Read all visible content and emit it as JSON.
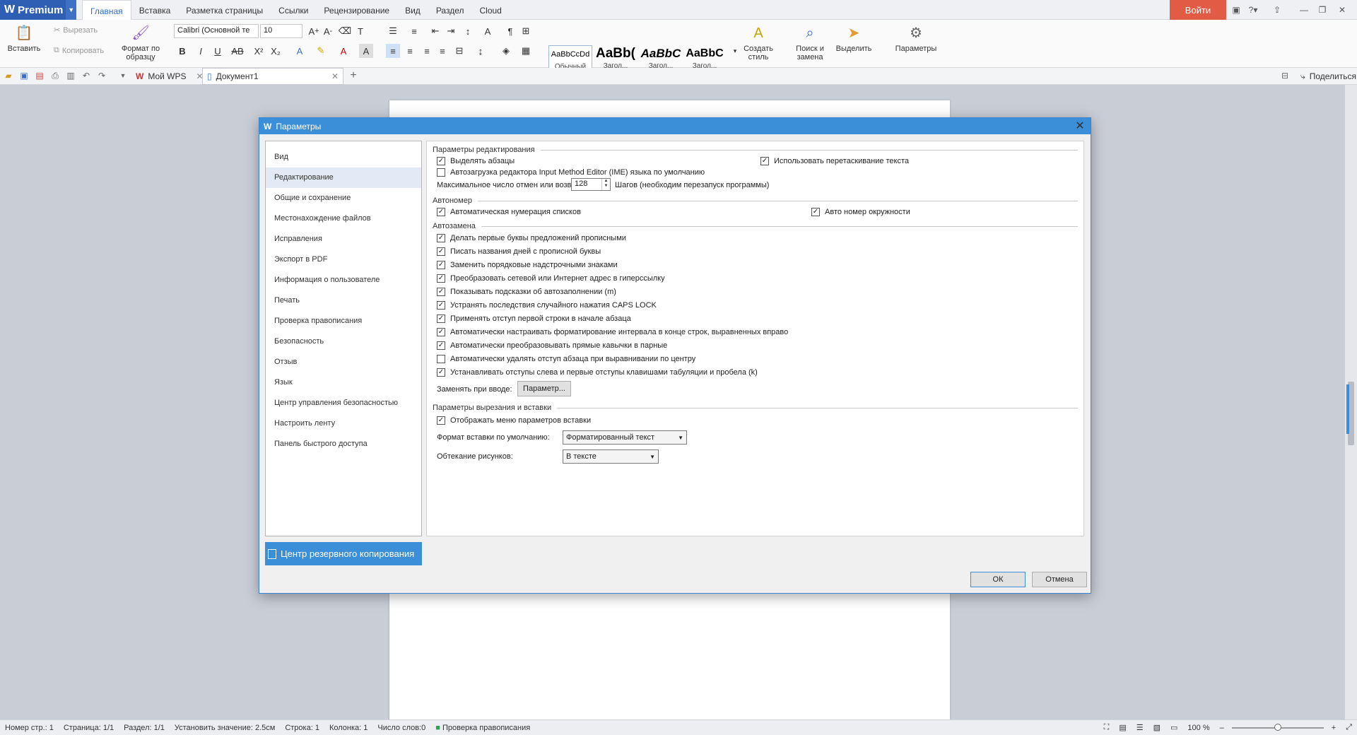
{
  "brand": {
    "name": "Premium"
  },
  "tabs": [
    "Главная",
    "Вставка",
    "Разметка страницы",
    "Ссылки",
    "Рецензирование",
    "Вид",
    "Раздел",
    "Cloud"
  ],
  "login_label": "Войти",
  "ribbon": {
    "paste": "Вставить",
    "cut": "Вырезать",
    "copy": "Копировать",
    "format_painter": "Формат по образцу",
    "font_name": "Calibri (Основной те",
    "font_size": "10",
    "styles": [
      {
        "sample": "AaBbCcDd",
        "label": "Обычный"
      },
      {
        "sample": "AaBb(",
        "label": "Загол..."
      },
      {
        "sample": "AaBbC",
        "label": "Загол..."
      },
      {
        "sample": "AaBbC",
        "label": "Загол..."
      }
    ],
    "create_style": "Создать стиль",
    "find_replace": "Поиск и замена",
    "select": "Выделить",
    "settings": "Параметры"
  },
  "quickbar": {
    "tab1": "Мой WPS",
    "tab2": "Документ1",
    "share": "Поделиться"
  },
  "status": {
    "page_num": "Номер стр.: 1",
    "page": "Страница: 1/1",
    "section": "Раздел: 1/1",
    "set_value": "Установить значение: 2.5см",
    "line": "Строка: 1",
    "column": "Колонка: 1",
    "words": "Число слов:0",
    "spell": "Проверка правописания",
    "zoom": "100 %"
  },
  "dialog": {
    "title": "Параметры",
    "nav": [
      "Вид",
      "Редактирование",
      "Общие и сохранение",
      "Местонахождение файлов",
      "Исправления",
      "Экспорт в PDF",
      "Информация о пользователе",
      "Печать",
      "Проверка правописания",
      "Безопасность",
      "Отзыв",
      "Язык",
      "Центр управления безопасностью",
      "Настроить ленту",
      "Панель быстрого доступа"
    ],
    "selected_nav": "Редактирование",
    "backup": "Центр резервного копирования",
    "sec_edit": "Параметры редактирования",
    "edit_opts": [
      {
        "label": "Выделять абзацы",
        "checked": true
      },
      {
        "label": "Использовать перетаскивание текста",
        "checked": true
      },
      {
        "label": "Автозагрузка редактора Input Method Editor (IME) языка по умолчанию",
        "checked": false
      }
    ],
    "undo_label": "Максимальное число отмен или возвратов:",
    "undo_value": "128",
    "undo_suffix": "Шагов (необходим перезапуск программы)",
    "sec_autonum": "Автономер",
    "autonum_opts": [
      {
        "label": "Автоматическая нумерация списков",
        "checked": true
      },
      {
        "label": "Авто номер окружности",
        "checked": true
      }
    ],
    "sec_autocorrect": "Автозамена",
    "autocorrect_opts": [
      {
        "label": "Делать первые буквы предложений прописными",
        "checked": true
      },
      {
        "label": "Писать названия дней с прописной буквы",
        "checked": true
      },
      {
        "label": "Заменить порядковые надстрочными знаками",
        "checked": true
      },
      {
        "label": "Преобразовать сетевой или Интернет адрес в гиперссылку",
        "checked": true
      },
      {
        "label": "Показывать подсказки об автозаполнении (m)",
        "checked": true
      },
      {
        "label": "Устранять последствия случайного нажатия CAPS LOCK",
        "checked": true
      },
      {
        "label": "Применять отступ первой строки в начале абзаца",
        "checked": true
      },
      {
        "label": "Автоматически настраивать форматирование интервала в конце строк, выравненных вправо",
        "checked": true
      },
      {
        "label": "Автоматически преобразовывать прямые кавычки в парные",
        "checked": true
      },
      {
        "label": "Автоматически удалять отступ абзаца при выравнивании по центру",
        "checked": false
      },
      {
        "label": "Устанавливать отступы слева и первые отступы клавишами табуляции и пробела (k)",
        "checked": true
      }
    ],
    "replace_label": "Заменять при вводе:",
    "replace_btn": "Параметр...",
    "sec_paste": "Параметры вырезания и вставки",
    "paste_opts": [
      {
        "label": "Отображать меню параметров вставки",
        "checked": true
      }
    ],
    "paste_format_label": "Формат вставки по умолчанию:",
    "paste_format_value": "Форматированный текст",
    "wrap_label": "Обтекание рисунков:",
    "wrap_value": "В тексте",
    "ok": "ОК",
    "cancel": "Отмена"
  }
}
